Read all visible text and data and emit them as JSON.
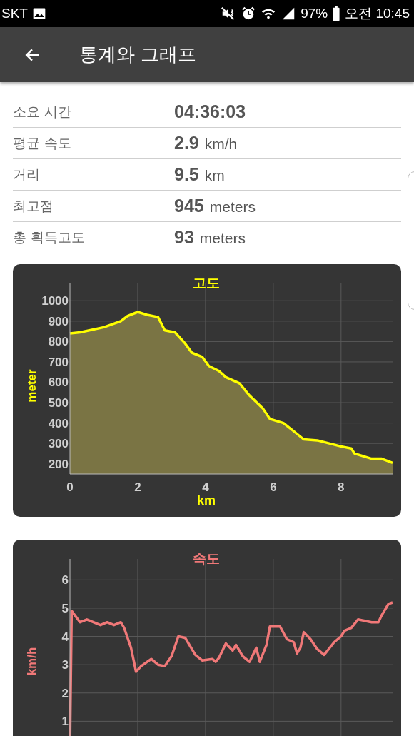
{
  "status_bar": {
    "carrier": "SKT",
    "battery": "97%",
    "time": "오전 10:45"
  },
  "app_bar": {
    "title": "통계와 그래프"
  },
  "stats": [
    {
      "label": "소요 시간",
      "value": "04:36:03"
    },
    {
      "label": "평균 속도",
      "value": "2.9",
      "unit": "km/h"
    },
    {
      "label": "거리",
      "value": "9.5",
      "unit": "km"
    },
    {
      "label": "최고점",
      "value": "945",
      "unit": "meters"
    },
    {
      "label": "총 획득고도",
      "value": "93",
      "unit": "meters"
    }
  ],
  "charts": [
    {
      "chart_data": {
        "type": "area",
        "title": "고도",
        "xlabel": "km",
        "ylabel": "meter",
        "xlim": [
          0,
          9.52
        ],
        "ylim": [
          150,
          1085
        ],
        "xticks": [
          0,
          2,
          4,
          6,
          8
        ],
        "yticks": [
          200,
          300,
          400,
          500,
          600,
          700,
          800,
          900,
          1000
        ],
        "x": [
          0,
          0.3,
          1,
          1.5,
          1.7,
          2,
          2.3,
          2.6,
          2.8,
          3.1,
          3.4,
          3.6,
          3.9,
          4.1,
          4.4,
          4.6,
          5,
          5.3,
          5.7,
          5.9,
          6.3,
          6.6,
          6.9,
          7.3,
          8,
          8.3,
          8.4,
          8.9,
          9.2,
          9.52
        ],
        "grid": true,
        "series": [
          {
            "color": "#ffff00",
            "values": [
              840,
              845,
              870,
              900,
              925,
              945,
              930,
              920,
              855,
              845,
              790,
              745,
              725,
              680,
              655,
              625,
              595,
              535,
              470,
              420,
              400,
              360,
              320,
              315,
              285,
              275,
              250,
              225,
              225,
              205
            ]
          }
        ]
      }
    },
    {
      "chart_data": {
        "type": "line",
        "title": "속도",
        "ylabel": "km/h",
        "xlim": [
          0,
          9.52
        ],
        "ylim": [
          0,
          6.74
        ],
        "yticks": [
          1,
          2,
          3,
          4,
          5,
          6
        ],
        "x": [
          0,
          0.05,
          0.3,
          0.5,
          0.9,
          1.1,
          1.3,
          1.5,
          1.6,
          1.8,
          1.95,
          2.1,
          2.4,
          2.6,
          2.8,
          3,
          3.2,
          3.4,
          3.7,
          3.9,
          4.2,
          4.3,
          4.4,
          4.6,
          4.8,
          4.9,
          5.1,
          5.3,
          5.5,
          5.6,
          5.8,
          5.9,
          6.2,
          6.4,
          6.6,
          6.7,
          6.8,
          6.9,
          7.1,
          7.3,
          7.5,
          7.8,
          8,
          8.1,
          8.3,
          8.5,
          8.7,
          8.9,
          9.1,
          9.2,
          9.4,
          9.52
        ],
        "grid": true,
        "series": [
          {
            "color": "#f07878",
            "values": [
              0,
              4.9,
              4.5,
              4.6,
              4.4,
              4.5,
              4.4,
              4.5,
              4.3,
              3.6,
              2.75,
              2.95,
              3.2,
              3,
              2.95,
              3.3,
              4,
              3.95,
              3.35,
              3.15,
              3.2,
              3.1,
              3.25,
              3.75,
              3.5,
              3.7,
              3.3,
              3.1,
              3.6,
              3.1,
              3.7,
              4.35,
              4.35,
              3.9,
              3.8,
              3.4,
              3.6,
              4.15,
              3.9,
              3.55,
              3.35,
              3.8,
              4,
              4.2,
              4.3,
              4.6,
              4.55,
              4.5,
              4.5,
              4.75,
              5.15,
              5.2
            ]
          }
        ]
      }
    }
  ]
}
